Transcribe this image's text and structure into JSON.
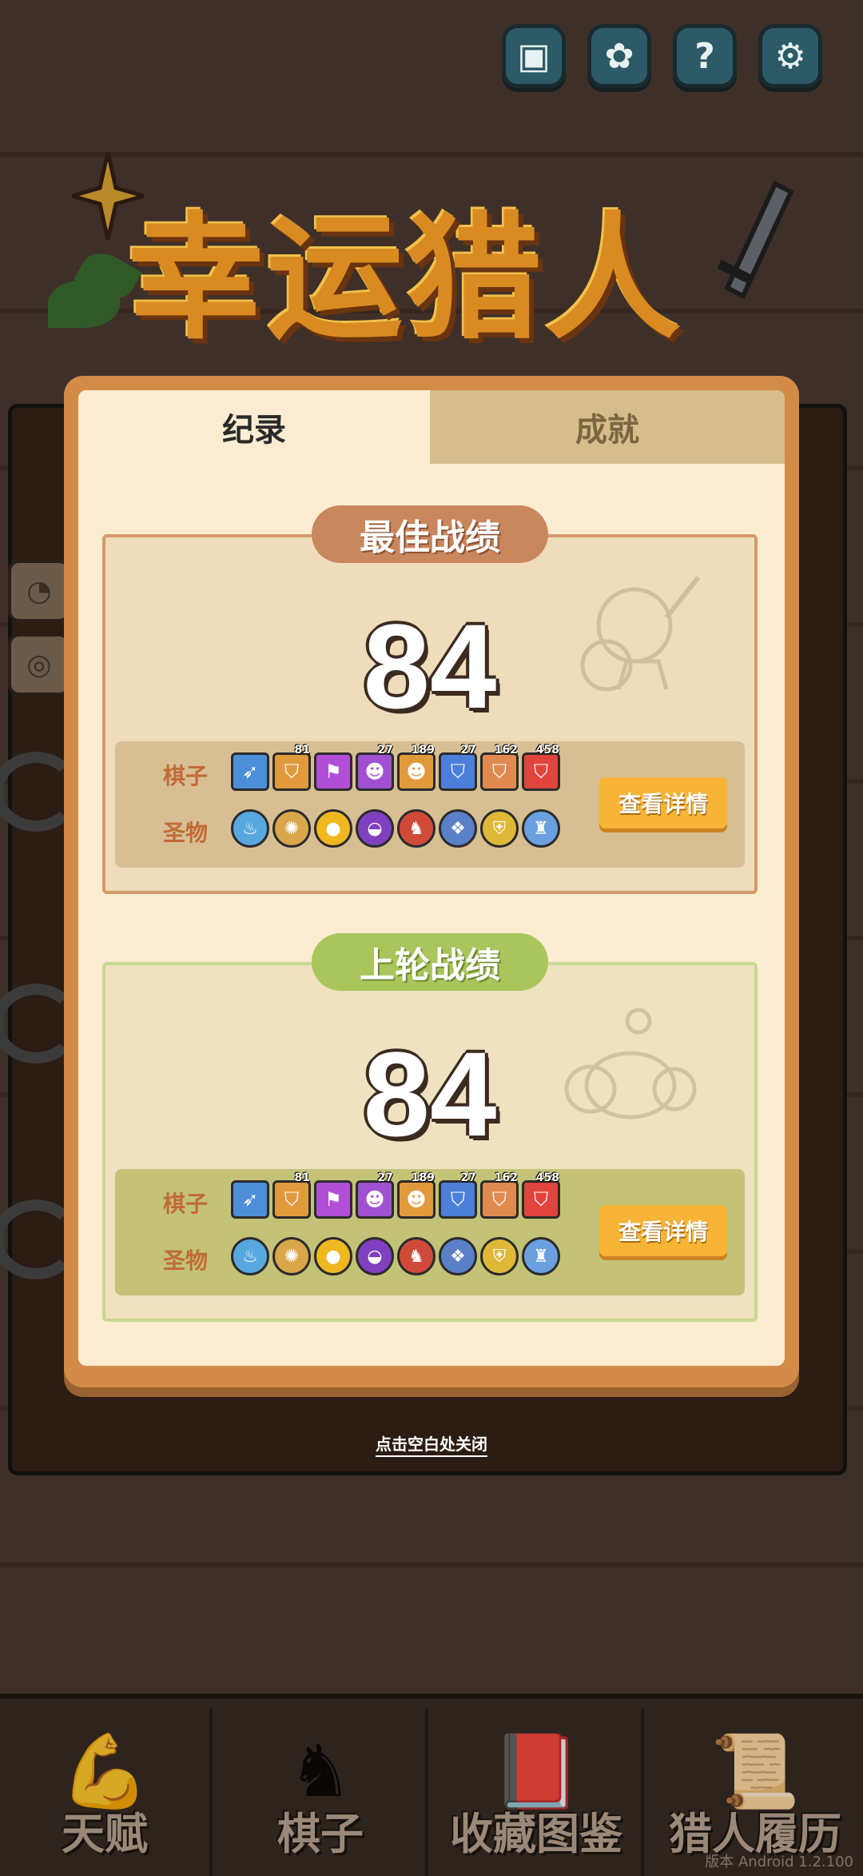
{
  "game_title": "幸运猎人",
  "top_icons": [
    "save-icon",
    "brain-icon",
    "help-icon",
    "gear-icon"
  ],
  "top_glyphs": [
    "▣",
    "✿",
    "?",
    "⚙"
  ],
  "tabs": {
    "records": "纪录",
    "achievements": "成就"
  },
  "best": {
    "header": "最佳战绩",
    "score": "84",
    "pieces_label": "棋子",
    "relics_label": "圣物",
    "detail_button": "查看详情"
  },
  "last": {
    "header": "上轮战绩",
    "score": "84",
    "pieces_label": "棋子",
    "relics_label": "圣物",
    "detail_button": "查看详情"
  },
  "pieces": [
    {
      "color": "#4c8fd8",
      "glyph": "➶",
      "level": ""
    },
    {
      "color": "#e09a3c",
      "glyph": "⛉",
      "level": "81"
    },
    {
      "color": "#b04fd6",
      "glyph": "⚑",
      "level": ""
    },
    {
      "color": "#a050d0",
      "glyph": "☻",
      "level": "27"
    },
    {
      "color": "#e09a3c",
      "glyph": "☻",
      "level": "189"
    },
    {
      "color": "#4c7fd8",
      "glyph": "⛉",
      "level": "27"
    },
    {
      "color": "#e08a50",
      "glyph": "⛉",
      "level": "162"
    },
    {
      "color": "#e0443c",
      "glyph": "⛉",
      "level": "458"
    }
  ],
  "relics": [
    {
      "color": "#58a8e0",
      "glyph": "♨"
    },
    {
      "color": "#d9a64a",
      "glyph": "✺"
    },
    {
      "color": "#f0b820",
      "glyph": "●"
    },
    {
      "color": "#8040c0",
      "glyph": "◒"
    },
    {
      "color": "#d04a3a",
      "glyph": "♞"
    },
    {
      "color": "#5a80c8",
      "glyph": "❖"
    },
    {
      "color": "#e0b838",
      "glyph": "⛨"
    },
    {
      "color": "#6aa0e0",
      "glyph": "♜"
    }
  ],
  "close_hint": "点击空白处关闭",
  "nav": [
    {
      "label": "天赋",
      "icon": "muscle-icon",
      "glyph": "💪"
    },
    {
      "label": "棋子",
      "icon": "knights-icon",
      "glyph": "♞"
    },
    {
      "label": "收藏图鉴",
      "icon": "book-icon",
      "glyph": "📕"
    },
    {
      "label": "猎人履历",
      "icon": "scroll-clock-icon",
      "glyph": "📜"
    }
  ],
  "watermark": "版本 Android 1.2.100"
}
